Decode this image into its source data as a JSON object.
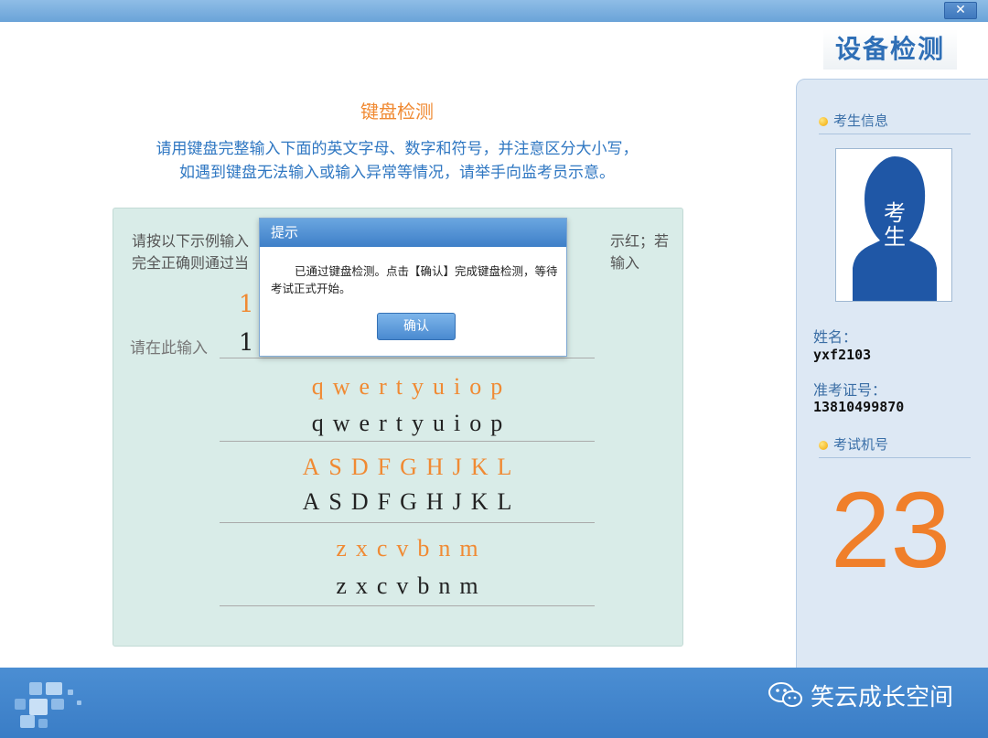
{
  "window": {
    "close_label": "✕"
  },
  "main": {
    "title": "键盘检测",
    "instructions": [
      "请用键盘完整输入下面的英文字母、数字和符号，并注意区分大小写，",
      "如遇到键盘无法输入或输入异常等情况，请举手向监考员示意。"
    ],
    "panel_text": {
      "line1_start": "请按以下示例输入",
      "line1_end": "示红；若输入",
      "line2_start": "完全正确则通过当"
    },
    "sample_top": "1",
    "input_label": "请在此输入",
    "input_top": "1",
    "rows": [
      {
        "sample": [
          "q",
          "w",
          "e",
          "r",
          "t",
          "y",
          "u",
          "i",
          "o",
          "p"
        ],
        "typed": [
          "q",
          "w",
          "e",
          "r",
          "t",
          "y",
          "u",
          "i",
          "o",
          "p"
        ]
      },
      {
        "sample": [
          "A",
          "S",
          "D",
          "F",
          "G",
          "H",
          "J",
          "K",
          "L"
        ],
        "typed": [
          "A",
          "S",
          "D",
          "F",
          "G",
          "H",
          "J",
          "K",
          "L"
        ]
      },
      {
        "sample": [
          "z",
          "x",
          "c",
          "v",
          "b",
          "n",
          "m"
        ],
        "typed": [
          "z",
          "x",
          "c",
          "v",
          "b",
          "n",
          "m"
        ]
      }
    ]
  },
  "sidebar": {
    "title": "设备检测",
    "candidate_info_heading": "考生信息",
    "photo_text": [
      "考",
      "生"
    ],
    "name_label": "姓名：",
    "name_value": "yxf2103",
    "id_label": "准考证号：",
    "id_value": "13810499870",
    "machine_heading": "考试机号",
    "machine_number": "23"
  },
  "dialog": {
    "title": "提示",
    "message": "已通过键盘检测。点击【确认】完成键盘检测，等待考试正式开始。",
    "confirm_label": "确认"
  },
  "footer": {
    "watermark": "笑云成长空间"
  },
  "colors": {
    "accent_orange": "#f08a33",
    "primary_blue": "#2f77c2",
    "panel_bg": "#d9ece8"
  }
}
